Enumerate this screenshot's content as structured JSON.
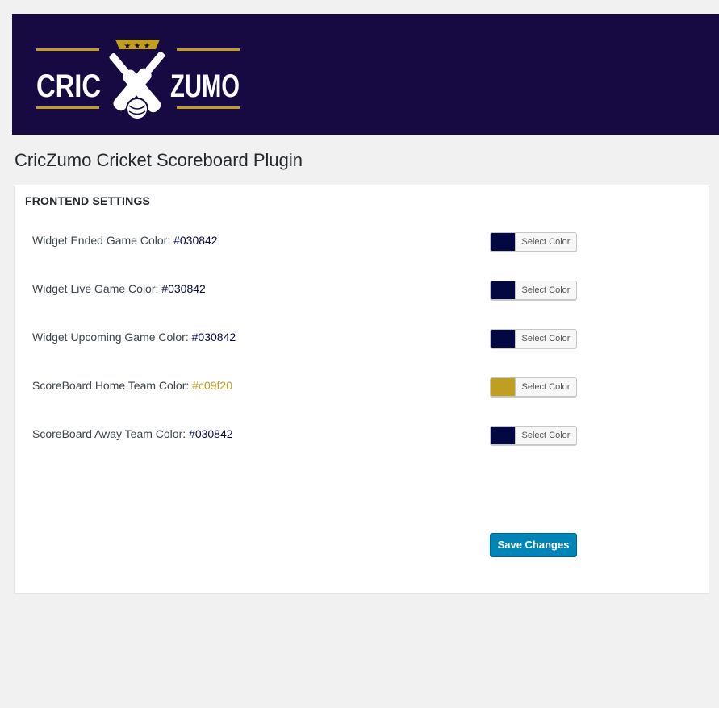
{
  "logo": {
    "left_text": "CRIC",
    "right_text": "ZUMO",
    "brand_color": "#c09f20",
    "background_color": "#170a42"
  },
  "page": {
    "title": "CricZumo Cricket Scoreboard Plugin"
  },
  "panel": {
    "heading": "FRONTEND SETTINGS",
    "settings": [
      {
        "label": "Widget Ended Game Color:",
        "value": "#030842",
        "color": "#030842",
        "button_label": "Select Color"
      },
      {
        "label": "Widget Live Game Color:",
        "value": "#030842",
        "color": "#030842",
        "button_label": "Select Color"
      },
      {
        "label": "Widget Upcoming Game Color:",
        "value": "#030842",
        "color": "#030842",
        "button_label": "Select Color"
      },
      {
        "label": "ScoreBoard Home Team Color:",
        "value": "#c09f20",
        "color": "#c09f20",
        "button_label": "Select Color"
      },
      {
        "label": "ScoreBoard Away Team Color:",
        "value": "#030842",
        "color": "#030842",
        "button_label": "Select Color"
      }
    ],
    "save_label": "Save Changes"
  }
}
